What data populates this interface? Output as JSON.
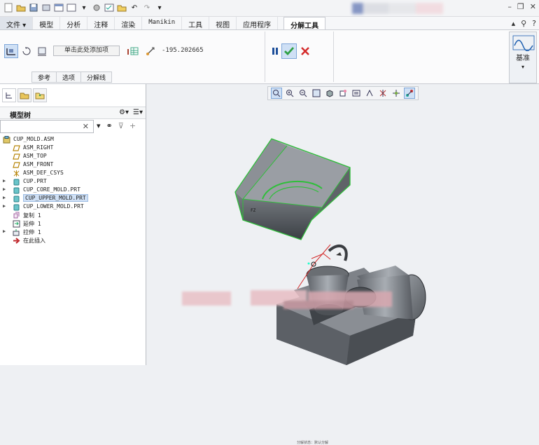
{
  "menubar": {
    "tabs": [
      "文件",
      "模型",
      "分析",
      "注释",
      "渲染",
      "Manikin",
      "工具",
      "视图",
      "应用程序"
    ],
    "active_tab": "分解工具"
  },
  "ribbon": {
    "add_item_label": "单击此处添加项",
    "value": "-195.202665",
    "subtabs": [
      "参考",
      "选项",
      "分解线"
    ],
    "base_button_label": "基准"
  },
  "model_tree": {
    "title": "模型树",
    "search_placeholder": "",
    "nodes": [
      {
        "label": "CUP_MOLD.ASM",
        "icon": "assembly-icon",
        "level": 0,
        "expandable": false
      },
      {
        "label": "ASM_RIGHT",
        "icon": "datum-plane-icon",
        "level": 1,
        "expandable": false
      },
      {
        "label": "ASM_TOP",
        "icon": "datum-plane-icon",
        "level": 1,
        "expandable": false
      },
      {
        "label": "ASM_FRONT",
        "icon": "datum-plane-icon",
        "level": 1,
        "expandable": false
      },
      {
        "label": "ASM_DEF_CSYS",
        "icon": "csys-icon",
        "level": 1,
        "expandable": false
      },
      {
        "label": "CUP.PRT",
        "icon": "part-icon",
        "level": 1,
        "expandable": true
      },
      {
        "label": "CUP_CORE_MOLD.PRT",
        "icon": "part-icon",
        "level": 1,
        "expandable": true
      },
      {
        "label": "CUP_UPPER_MOLD.PRT",
        "icon": "part-icon",
        "level": 1,
        "expandable": true,
        "highlighted": true
      },
      {
        "label": "CUP_LOWER_MOLD.PRT",
        "icon": "part-icon",
        "level": 1,
        "expandable": true
      },
      {
        "label": "复制 1",
        "icon": "copy-icon",
        "level": 1,
        "expandable": false
      },
      {
        "label": "延伸 1",
        "icon": "extend-icon",
        "level": 1,
        "expandable": false
      },
      {
        "label": "拉伸 1",
        "icon": "extrude-icon",
        "level": 1,
        "expandable": true
      },
      {
        "label": "在此插入",
        "icon": "insert-arrow-icon",
        "level": 1,
        "expandable": false
      }
    ]
  },
  "canvas": {
    "status_text": "分解状态：默认分解"
  },
  "colors": {
    "selection_green": "#2fbf3a",
    "model_gray": "#6f7378",
    "accept_green": "#2ea043",
    "cancel_red": "#d42b2b"
  }
}
